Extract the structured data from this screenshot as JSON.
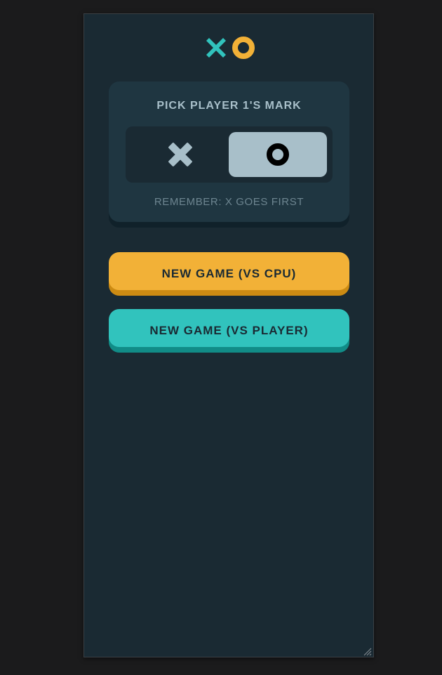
{
  "app": {
    "logo_icons": [
      "x-mark-icon",
      "o-mark-icon"
    ],
    "colors": {
      "x": "#31c3bd",
      "o": "#f2b137",
      "background": "#1a2a33",
      "card": "#1f3641",
      "silver": "#a8bfc9",
      "muted": "#6d8590"
    }
  },
  "mark_picker": {
    "title": "PICK PLAYER 1'S MARK",
    "options": [
      {
        "mark": "X",
        "icon": "x-mark-icon",
        "selected": false
      },
      {
        "mark": "O",
        "icon": "o-mark-icon",
        "selected": true
      }
    ],
    "hint": "REMEMBER: X GOES FIRST"
  },
  "actions": {
    "vs_cpu_label": "NEW GAME (VS CPU)",
    "vs_player_label": "NEW GAME (VS PLAYER)"
  }
}
